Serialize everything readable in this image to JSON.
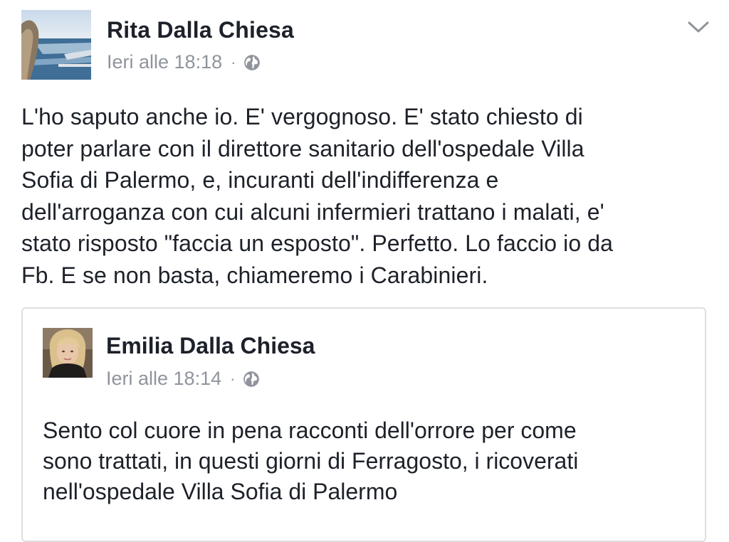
{
  "post": {
    "author": "Rita Dalla Chiesa",
    "timestamp": "Ieri alle 18:18",
    "separator": "·",
    "privacy_icon": "globe-icon",
    "menu_icon": "chevron-down-icon",
    "text": "L'ho saputo anche io. E' vergognoso. E' stato chiesto di\npoter parlare con il direttore sanitario dell'ospedale Villa\nSofia di Palermo, e, incuranti dell'indifferenza e\ndell'arroganza  con cui alcuni infermieri trattano i malati, e'\nstato risposto \"faccia un esposto\". Perfetto. Lo faccio io da\nFb. E se non basta, chiameremo i Carabinieri."
  },
  "shared": {
    "author": "Emilia Dalla Chiesa",
    "timestamp": "Ieri alle 18:14",
    "separator": "·",
    "privacy_icon": "globe-icon",
    "text": "Sento col cuore in pena racconti dell'orrore per come\nsono trattati, in questi giorni di Ferragosto, i ricoverati\nnell'ospedale Villa Sofia di Palermo"
  },
  "colors": {
    "name": "#1d2129",
    "meta": "#90949c",
    "border": "#dddfe2",
    "chevron": "#90949c"
  }
}
